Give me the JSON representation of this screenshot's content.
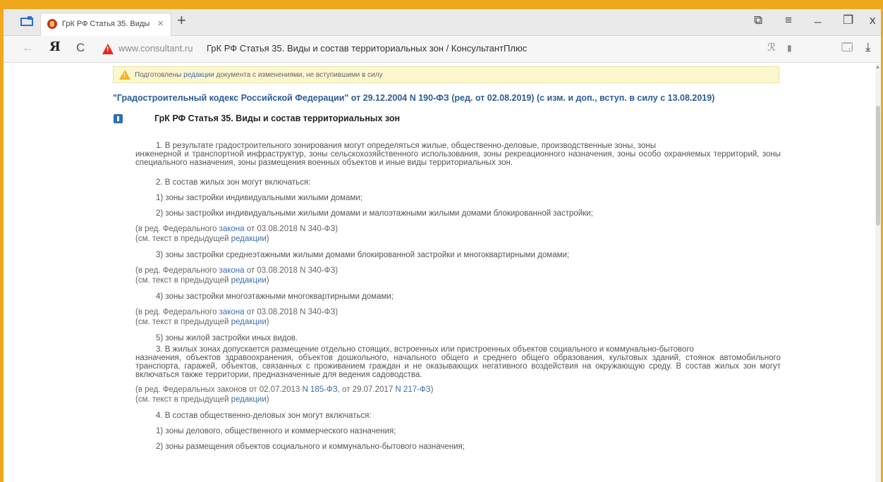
{
  "browser": {
    "tab_title": "ГрК РФ Статья 35. Виды",
    "tab_close": "×",
    "new_tab": "+",
    "address_domain": "www.consultant.ru",
    "address_title": "ГрК РФ Статья 35. Виды и состав территориальных зон / КонсультантПлюс",
    "icons": {
      "tabs": "tabs-icon",
      "favicon": "consultant-favicon",
      "back": "back-arrow-icon",
      "yandex": "yandex-logo",
      "reload": "reload-icon",
      "security": "warning-icon",
      "reader": "reader-mode-icon",
      "bookmark": "bookmark-icon",
      "translate": "translate-icon",
      "download": "download-icon",
      "tabs_collections": "collections-icon",
      "menu": "menu-icon",
      "minimize": "minimize-icon",
      "restore": "restore-icon",
      "close": "close-icon"
    },
    "glyphs": {
      "back": "←",
      "yandex": "Я",
      "reload": "C",
      "reader": "ℛ",
      "bookmark": "▮",
      "translate": "🗔",
      "download": "⤓",
      "collections": "⧉",
      "menu": "≡",
      "minimize": "_",
      "restore": "❐",
      "close": "x"
    }
  },
  "page": {
    "notice_prefix": "Подготовлены ",
    "notice_link": "редакции",
    "notice_suffix": " документа с изменениями, не вступившими в силу",
    "doc_title": "\"Градостроительный кодекс Российской Федерации\" от 29.12.2004 N 190-ФЗ (ред. от 02.08.2019) (с изм. и доп., вступ. в силу с 13.08.2019)",
    "article_title": "ГрК РФ Статья 35. Виды и состав территориальных зон",
    "p1_line1": "1. В результате градостроительного зонирования могут определяться жилые, общественно-деловые, производственные зоны, зоны",
    "p1_rest": "инженерной и транспортной инфраструктур, зоны сельскохозяйственного использования, зоны рекреационного назначения, зоны особо охраняемых территорий, зоны специального назначения, зоны размещения военных объектов и иные виды территориальных зон.",
    "p2": "2. В состав жилых зон могут включаться:",
    "p2_1": "1) зоны застройки индивидуальными жилыми домами;",
    "p2_2": "2) зоны застройки индивидуальными жилыми домами и малоэтажными жилыми домами блокированной застройки;",
    "note_red_fed_prefix": "(в ред. Федерального ",
    "note_law_link": "закона",
    "note_law_suffix": " от 03.08.2018 N 340-ФЗ)",
    "note_prev_prefix": "(см. текст в предыдущей ",
    "note_prev_link": "редакции",
    "note_prev_suffix": ")",
    "p2_3": "3) зоны застройки среднеэтажными жилыми домами блокированной застройки и многоквартирными домами;",
    "p2_4": "4) зоны застройки многоэтажными многоквартирными домами;",
    "p2_5": "5) зоны жилой застройки иных видов.",
    "p3_line1": "3. В жилых зонах допускается размещение отдельно стоящих, встроенных или пристроенных объектов социального и коммунально-бытового",
    "p3_rest": "назначения, объектов здравоохранения, объектов дошкольного, начального общего и среднего общего образования, культовых зданий, стоянок автомобильного транспорта, гаражей, объектов, связанных с проживанием граждан и не оказывающих негативного воздействия на окружающую среду. В состав жилых зон могут включаться также территории, предназначенные для ведения садоводства.",
    "note3_prefix": "(в ред. Федеральных законов от 02.07.2013 ",
    "note3_link1": "N 185-ФЗ",
    "note3_mid": ", от 29.07.2017 ",
    "note3_link2": "N 217-ФЗ",
    "note3_suffix": ")",
    "p4": "4. В состав общественно-деловых зон могут включаться:",
    "p4_1": "1) зоны делового, общественного и коммерческого назначения;",
    "p4_2": "2) зоны размещения объектов социального и коммунально-бытового назначения;"
  }
}
